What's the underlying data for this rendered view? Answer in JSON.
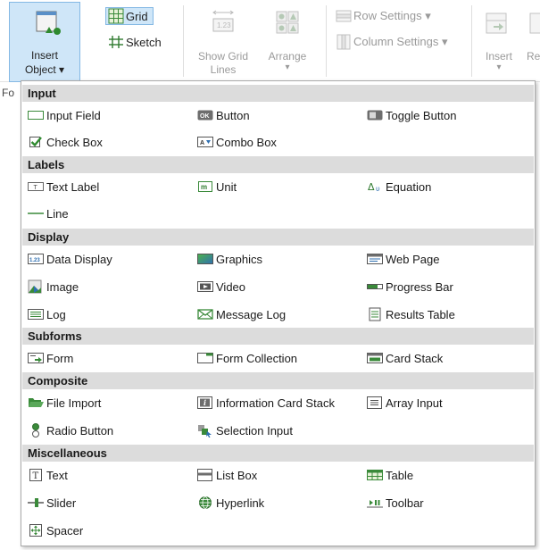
{
  "ribbon": {
    "insert_object": {
      "line1": "Insert",
      "line2": "Object ▾"
    },
    "grid": "Grid",
    "sketch": "Sketch",
    "show_grid_lines": {
      "line1": "Show Grid",
      "line2": "Lines"
    },
    "arrange": {
      "line1": "Arrange",
      "line2": "▾"
    },
    "row_settings": "Row Settings ▾",
    "column_settings": "Column Settings ▾",
    "insert": {
      "line1": "Insert",
      "line2": "▾"
    },
    "cut_label": "Re",
    "left_cut": "Fo"
  },
  "menu": {
    "sections": [
      {
        "title": "Input",
        "items": [
          "Input Field",
          "Button",
          "Toggle Button",
          "Check Box",
          "Combo Box"
        ]
      },
      {
        "title": "Labels",
        "items": [
          "Text Label",
          "Unit",
          "Equation",
          "Line"
        ]
      },
      {
        "title": "Display",
        "items": [
          "Data Display",
          "Graphics",
          "Web Page",
          "Image",
          "Video",
          "Progress Bar",
          "Log",
          "Message Log",
          "Results Table"
        ]
      },
      {
        "title": "Subforms",
        "items": [
          "Form",
          "Form Collection",
          "Card Stack"
        ]
      },
      {
        "title": "Composite",
        "items": [
          "File Import",
          "Information Card Stack",
          "Array Input",
          "Radio Button",
          "Selection Input"
        ]
      },
      {
        "title": "Miscellaneous",
        "items": [
          "Text",
          "List Box",
          "Table",
          "Slider",
          "Hyperlink",
          "Toolbar",
          "Spacer"
        ]
      }
    ]
  },
  "colors": {
    "ribbon_selected_bg": "#cfe6f8",
    "ribbon_selected_border": "#84b8e4",
    "section_header_bg": "#dcdcdc",
    "accent_green": "#3a8a3a"
  }
}
